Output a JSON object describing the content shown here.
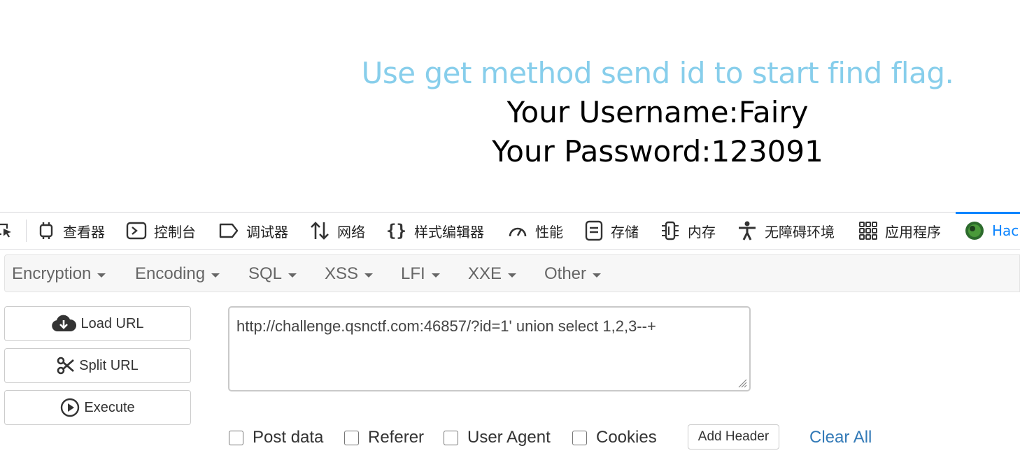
{
  "page": {
    "message": "Use get method send id to start find flag.",
    "username_line": "Your Username:Fairy",
    "password_line": "Your Password:123091",
    "message_color": "#87CEEB"
  },
  "devtools": {
    "tabs": [
      {
        "label": "查看器",
        "icon": "inspector-icon"
      },
      {
        "label": "控制台",
        "icon": "console-icon"
      },
      {
        "label": "调试器",
        "icon": "debugger-icon"
      },
      {
        "label": "网络",
        "icon": "network-icon"
      },
      {
        "label": "样式编辑器",
        "icon": "style-editor-icon"
      },
      {
        "label": "性能",
        "icon": "performance-icon"
      },
      {
        "label": "存储",
        "icon": "storage-icon"
      },
      {
        "label": "内存",
        "icon": "memory-icon"
      },
      {
        "label": "无障碍环境",
        "icon": "accessibility-icon"
      },
      {
        "label": "应用程序",
        "icon": "application-icon"
      },
      {
        "label": "Hac",
        "icon": "hackbar-icon"
      }
    ],
    "active_color": "#0a84ff"
  },
  "hackbar": {
    "menu": [
      "Encryption",
      "Encoding",
      "SQL",
      "XSS",
      "LFI",
      "XXE",
      "Other"
    ],
    "load_url": "Load URL",
    "split_url": "Split URL",
    "execute": "Execute",
    "url_value": "http://challenge.qsnctf.com:46857/?id=1' union select 1,2,3--+",
    "options": {
      "post_data": "Post data",
      "referer": "Referer",
      "user_agent": "User Agent",
      "cookies": "Cookies"
    },
    "add_header": "Add Header",
    "clear_all": "Clear All",
    "link_color": "#337ab7"
  }
}
